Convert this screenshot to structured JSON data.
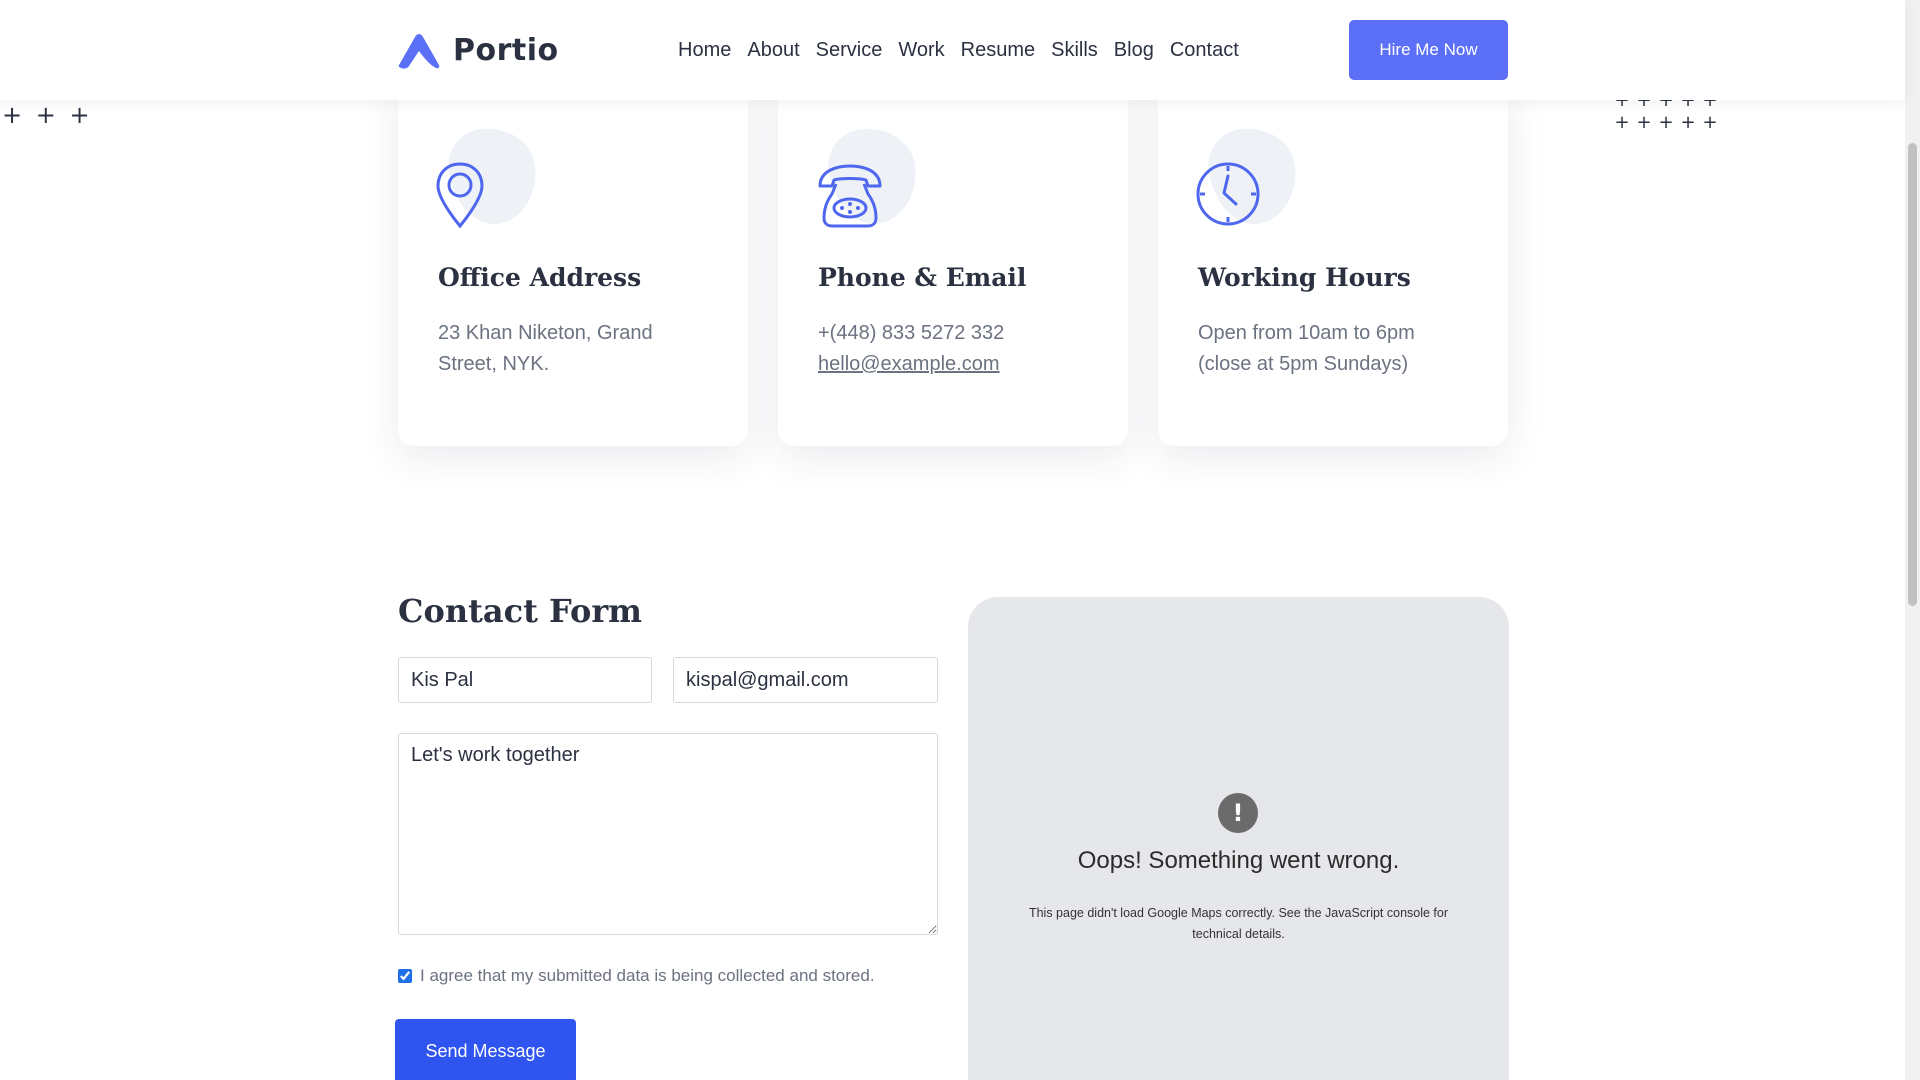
{
  "header": {
    "brand": "Portio",
    "nav": [
      "Home",
      "About",
      "Service",
      "Work",
      "Resume",
      "Skills",
      "Blog",
      "Contact"
    ],
    "cta_label": "Hire Me Now"
  },
  "info_cards": [
    {
      "icon": "map-pin-icon",
      "title": "Office Address",
      "lines": [
        "23 Khan Niketon, Grand",
        "Street, NYK."
      ]
    },
    {
      "icon": "telephone-icon",
      "title": "Phone & Email",
      "lines": [
        "+(448) 833 5272 332"
      ],
      "link": "hello@example.com"
    },
    {
      "icon": "clock-icon",
      "title": "Working Hours",
      "lines": [
        "Open from 10am to 6pm",
        "(close at 5pm Sundays)"
      ]
    }
  ],
  "contact_form": {
    "title": "Contact Form",
    "name_value": "Kis Pal",
    "email_value": "kispal@gmail.com",
    "message_value": "Let's work together",
    "agree_checked": true,
    "agree_label": "I agree that my submitted data is being collected and stored.",
    "submit_label": "Send Message"
  },
  "map": {
    "error_icon": "!",
    "error_title": "Oops! Something went wrong.",
    "error_text": "This page didn't load Google Maps correctly. See the JavaScript console for technical details."
  },
  "colors": {
    "accent": "#5b70f7",
    "submit": "#2f54f0",
    "heading": "#2b3140",
    "muted": "#6b7280"
  }
}
